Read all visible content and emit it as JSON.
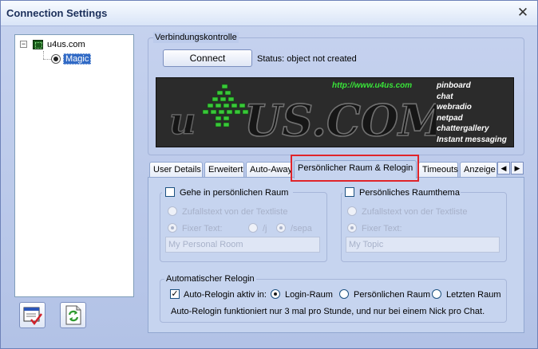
{
  "window": {
    "title": "Connection Settings"
  },
  "tree": {
    "root": "u4us.com",
    "child": "Magic"
  },
  "verbindung": {
    "group_label": "Verbindungskontrolle",
    "connect_label": "Connect",
    "status_text": "Status: object not created"
  },
  "banner": {
    "url": "http://www.u4us.com",
    "logo_text": "US.COM",
    "features": [
      "pinboard",
      "chat",
      "webradio",
      "netpad",
      "chattergallery",
      "Instant messaging"
    ]
  },
  "tabs": [
    "User Details",
    "Erweitert",
    "Auto-Away",
    "Persönlicher Raum & Relogin",
    "Timeouts",
    "Anzeige"
  ],
  "tab_arrows": {
    "left": "◀",
    "right": "▶"
  },
  "personal_room": {
    "checkbox_label": "Gehe in persönlichen Raum",
    "radio_random": "Zufallstext von der Textliste",
    "radio_fixed": "Fixer Text:",
    "radio_j": "/j",
    "radio_sepa": "/sepa",
    "text_value": "My Personal Room"
  },
  "room_theme": {
    "checkbox_label": "Persönliches Raumthema",
    "radio_random": "Zufallstext von der Textliste",
    "radio_fixed": "Fixer Text:",
    "text_value": "My Topic"
  },
  "relogin": {
    "group_label": "Automatischer Relogin",
    "checkbox_label": "Auto-Relogin aktiv in:",
    "checkbox_mark": "✓",
    "option_login": "Login-Raum",
    "option_personal": "Persönlichen Raum",
    "option_last": "Letzten Raum",
    "info": "Auto-Relogin funktioniert nur 3 mal pro Stunde, und nur bei einem Nick pro Chat."
  },
  "colors": {
    "highlight": "#e0242a",
    "banner_bg": "#2b2b2b",
    "banner_green": "#39e539"
  }
}
